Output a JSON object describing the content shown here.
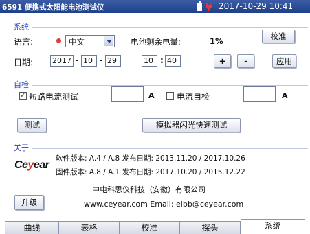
{
  "titlebar": {
    "title": "6591 便携式太阳能电池测试仪",
    "datetime": "2017-10-29  10:41"
  },
  "system": {
    "section_label": "系统",
    "language_label": "语言:",
    "language_value": "中文",
    "battery_label": "电池剩余电量:",
    "battery_value": "1%",
    "calibrate_label": "校准",
    "date_label": "日期:",
    "year": "2017",
    "month": "10",
    "day": "29",
    "hour": "10",
    "minute": "40",
    "date_sep": "-",
    "time_sep": ":",
    "plus_label": "+",
    "minus_label": "-",
    "apply_label": "应用"
  },
  "selfcheck": {
    "section_label": "自检",
    "short_circuit_label": "短路电流测试",
    "short_circuit_value": "",
    "unit_a": "A",
    "current_check_label": "电流自检",
    "current_check_value": "",
    "test_label": "测试",
    "simulator_label": "模拟器闪光快速测试"
  },
  "about": {
    "section_label": "关于",
    "software_line": "软件版本: A.4 / A.8  发布日期: 2013.11.20  / 2017.10.26",
    "firmware_line": "固件版本: A.8 / A.1  发布日期: 2017.10.20 / 2015.12.22",
    "company": "中电科思仪科技（安徽）有限公司",
    "contact": "www.ceyear.com   Email: eibb@ceyear.com",
    "upgrade_label": "升级",
    "logo_text": "Ceyear"
  },
  "tabs": [
    {
      "label": "曲线"
    },
    {
      "label": "表格"
    },
    {
      "label": "校准"
    },
    {
      "label": "探头"
    },
    {
      "label": "系统"
    }
  ],
  "colors": {
    "titlebar": "#1e3f8a",
    "section_label": "#2946b8",
    "accent_red": "#d3271f"
  }
}
